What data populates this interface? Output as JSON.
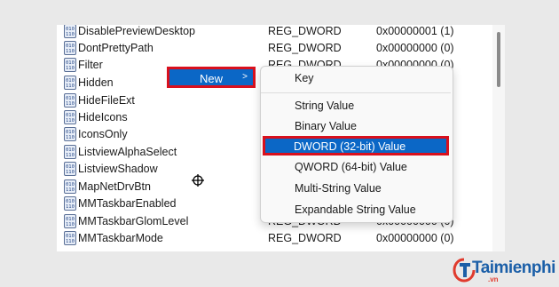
{
  "registry": {
    "rows": [
      {
        "name": "DisablePreviewDesktop",
        "type": "REG_DWORD",
        "data": "0x00000001 (1)"
      },
      {
        "name": "DontPrettyPath",
        "type": "REG_DWORD",
        "data": "0x00000000 (0)"
      },
      {
        "name": "Filter",
        "type": "REG_DWORD",
        "data": "0x00000000 (0)"
      },
      {
        "name": "Hidden",
        "type": "",
        "data": ""
      },
      {
        "name": "HideFileExt",
        "type": "",
        "data": ""
      },
      {
        "name": "HideIcons",
        "type": "",
        "data": ""
      },
      {
        "name": "IconsOnly",
        "type": "",
        "data": ""
      },
      {
        "name": "ListviewAlphaSelect",
        "type": "",
        "data": ""
      },
      {
        "name": "ListviewShadow",
        "type": "",
        "data": ""
      },
      {
        "name": "MapNetDrvBtn",
        "type": "",
        "data": ""
      },
      {
        "name": "MMTaskbarEnabled",
        "type": "",
        "data": ""
      },
      {
        "name": "MMTaskbarGlomLevel",
        "type": "REG_DWORD",
        "data": "0x00000000 (0)"
      },
      {
        "name": "MMTaskbarMode",
        "type": "REG_DWORD",
        "data": "0x00000000 (0)"
      }
    ]
  },
  "context_menu": {
    "new_label": "New",
    "new_arrow": ">"
  },
  "submenu": {
    "key": "Key",
    "string_value": "String Value",
    "binary_value": "Binary Value",
    "dword_value": "DWORD (32-bit) Value",
    "qword_value": "QWORD (64-bit) Value",
    "multi_string_value": "Multi-String Value",
    "expandable_string_value": "Expandable String Value"
  },
  "watermark": {
    "brand": "Taimienphi",
    "domain": ".vn"
  },
  "colors": {
    "highlight": "#0b67c6",
    "annotation_border": "#d9101d",
    "brand": "#1b5fa8"
  }
}
